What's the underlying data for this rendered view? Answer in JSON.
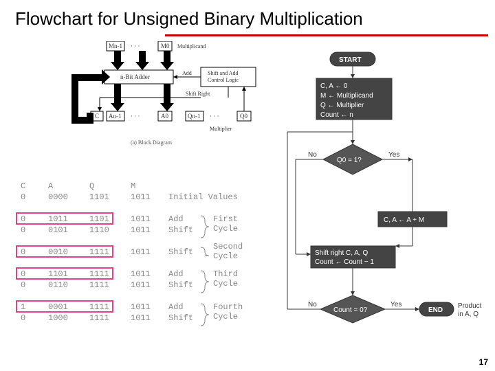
{
  "title": "Flowchart for Unsigned Binary Multiplication",
  "page_number": "17",
  "block_diagram": {
    "caption": "(a) Block Diagram",
    "multiplicand_hi": "Mn-1",
    "multiplicand_lo": "M0",
    "adder": "n-Bit Adder",
    "add_label": "Add",
    "control": "Shift and Add\nControl Logic",
    "shift_right": "Shift Right",
    "c": "C",
    "a_hi": "An-1",
    "a_lo": "A0",
    "q_hi": "Qn-1",
    "q_lo": "Q0",
    "multiplier": "Multiplier",
    "multiplicand": "Multiplicand"
  },
  "trace": {
    "headers": {
      "c": "C",
      "a": "A",
      "q": "Q",
      "m": "M"
    },
    "rows": [
      {
        "c": "0",
        "a": "0000",
        "q": "1101",
        "m": "1011",
        "op": "Initial Values"
      },
      {
        "c": "0",
        "a": "1011",
        "q": "1101",
        "m": "1011",
        "op": "Add"
      },
      {
        "c": "0",
        "a": "0101",
        "q": "1110",
        "m": "1011",
        "op": "Shift"
      },
      {
        "c": "0",
        "a": "0010",
        "q": "1111",
        "m": "1011",
        "op": "Shift"
      },
      {
        "c": "0",
        "a": "1101",
        "q": "1111",
        "m": "1011",
        "op": "Add"
      },
      {
        "c": "0",
        "a": "0110",
        "q": "1111",
        "m": "1011",
        "op": "Shift"
      },
      {
        "c": "1",
        "a": "0001",
        "q": "1111",
        "m": "1011",
        "op": "Add"
      },
      {
        "c": "0",
        "a": "1000",
        "q": "1111",
        "m": "1011",
        "op": "Shift"
      }
    ],
    "cycles": [
      "First\nCycle",
      "Second\nCycle",
      "Third\nCycle",
      "Fourth\nCycle"
    ]
  },
  "flowchart": {
    "start": "START",
    "init": "C, A ← 0\nM ← Multiplicand\nQ ← Multiplier\nCount ← n",
    "q0test": "Q0 = 1?",
    "add": "C, A ← A + M",
    "shift": "Shift right C, A, Q\nCount ← Count − 1",
    "count0": "Count = 0?",
    "end": "END",
    "product": "Product\nin A, Q",
    "yes": "Yes",
    "no": "No"
  }
}
